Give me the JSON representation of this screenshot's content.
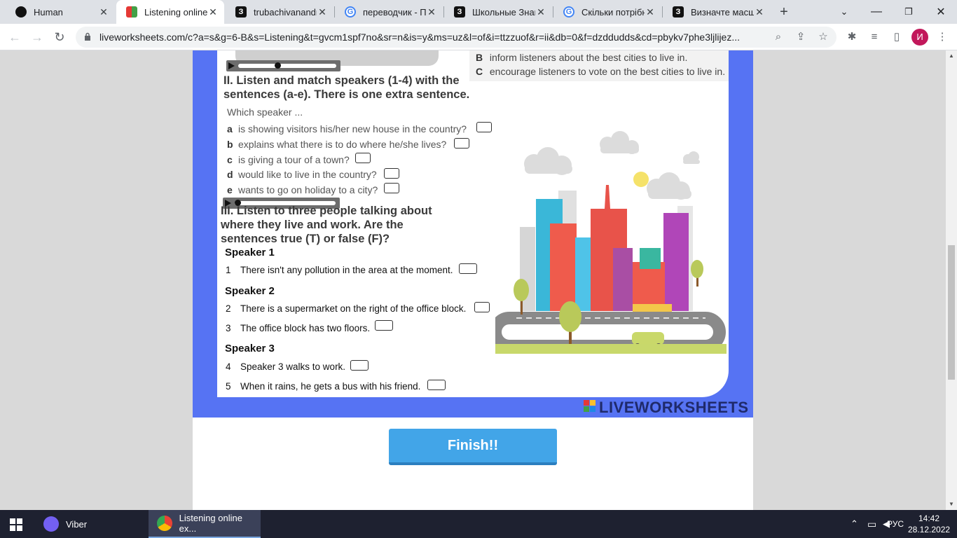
{
  "browser": {
    "tabs": [
      {
        "title": "Human",
        "favicon": "github-icon",
        "active": false
      },
      {
        "title": "Listening online e",
        "favicon": "liveworksheets-icon",
        "active": true
      },
      {
        "title": "trubachivanandre",
        "favicon": "znanija-icon",
        "active": false
      },
      {
        "title": "переводчик - По",
        "favicon": "google-icon",
        "active": false
      },
      {
        "title": "Школьные Знан",
        "favicon": "znanija-icon",
        "active": false
      },
      {
        "title": "Скільки потрібн",
        "favicon": "google-icon",
        "active": false
      },
      {
        "title": "Визначте масшт",
        "favicon": "znanija-icon",
        "active": false
      }
    ],
    "url": "liveworksheets.com/c?a=s&g=6-B&s=Listening&t=gvcm1spf7no&sr=n&is=y&ms=uz&l=of&i=ttzzuof&r=ii&db=0&f=dzddudds&cd=pbykv7phe3ljlijez...",
    "profile_initial": "И"
  },
  "worksheet": {
    "section1_options": [
      {
        "letter": "B",
        "text": "inform listeners about the best cities to live in."
      },
      {
        "letter": "C",
        "text": "encourage listeners to vote on the best cities to live in."
      }
    ],
    "section2": {
      "heading": "II. Listen and match speakers (1-4) with the sentences (a-e). There is one extra sentence.",
      "prompt": "Which speaker ...",
      "items": [
        {
          "letter": "a",
          "text": "is showing visitors his/her new house in the country?"
        },
        {
          "letter": "b",
          "text": "explains what there is to do where he/she lives?"
        },
        {
          "letter": "c",
          "text": "is giving a tour of a town?"
        },
        {
          "letter": "d",
          "text": "would like to live in the country?"
        },
        {
          "letter": "e",
          "text": "wants to go on holiday to a city?"
        }
      ]
    },
    "section3": {
      "heading": "III. Listen to three people talking about where they live and work. Are the sentences true (T) or false (F)?",
      "speakers": [
        {
          "name": "Speaker 1",
          "statements": [
            {
              "num": "1",
              "text": "There isn't any pollution in the area at the moment."
            }
          ]
        },
        {
          "name": "Speaker 2",
          "statements": [
            {
              "num": "2",
              "text": "There is a supermarket on the right of the office block."
            },
            {
              "num": "3",
              "text": "The office block has two floors."
            }
          ]
        },
        {
          "name": "Speaker 3",
          "statements": [
            {
              "num": "4",
              "text": "Speaker 3 walks to work."
            },
            {
              "num": "5",
              "text": "When it rains, he gets a bus with his friend."
            }
          ]
        }
      ]
    },
    "brand": "LIVEWORKSHEETS",
    "finish_label": "Finish!!"
  },
  "taskbar": {
    "apps": [
      {
        "label": "Viber",
        "active": false
      },
      {
        "label": "Listening online ex...",
        "active": true
      }
    ],
    "language": "РУС",
    "time": "14:42",
    "date": "28.12.2022"
  },
  "colors": {
    "sheet_blue": "#5673f3",
    "finish_button": "#42a5e8",
    "brand_navy": "#1f2a6b"
  }
}
